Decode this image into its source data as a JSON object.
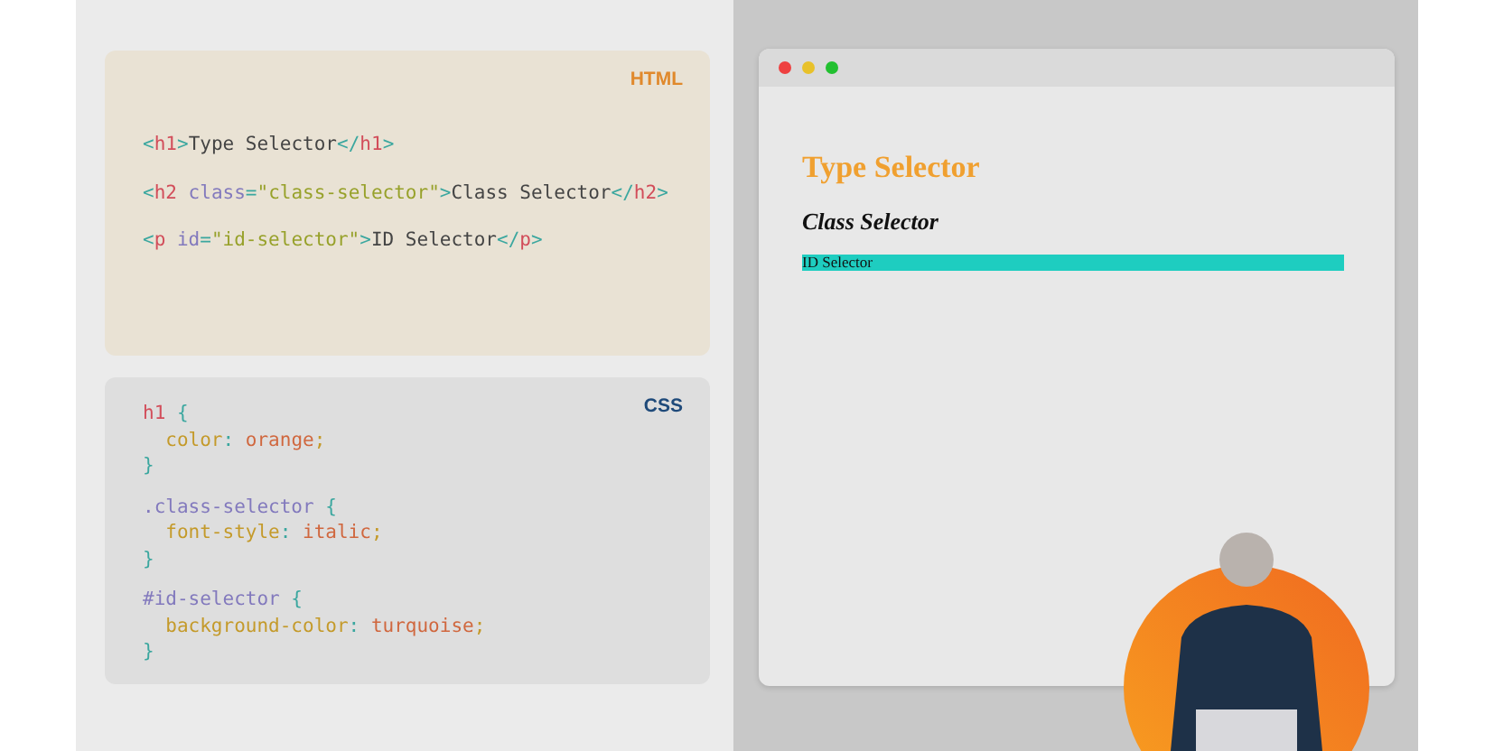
{
  "html_panel": {
    "label": "HTML",
    "lines": [
      {
        "tokens": [
          {
            "t": "<",
            "kind": "punct"
          },
          {
            "t": "h1",
            "kind": "tag"
          },
          {
            "t": ">",
            "kind": "punct"
          },
          {
            "t": "Type Selector",
            "kind": "text"
          },
          {
            "t": "</",
            "kind": "punct"
          },
          {
            "t": "h1",
            "kind": "tag"
          },
          {
            "t": ">",
            "kind": "punct"
          }
        ]
      },
      {
        "tokens": [
          {
            "t": "<",
            "kind": "punct"
          },
          {
            "t": "h2",
            "kind": "tag"
          },
          {
            "t": " class",
            "kind": "attr"
          },
          {
            "t": "=",
            "kind": "punct"
          },
          {
            "t": "\"class-selector\"",
            "kind": "string"
          },
          {
            "t": ">",
            "kind": "punct"
          },
          {
            "t": "Class Selector",
            "kind": "text"
          },
          {
            "t": "</",
            "kind": "punct"
          },
          {
            "t": "h2",
            "kind": "tag"
          },
          {
            "t": ">",
            "kind": "punct"
          }
        ]
      },
      {
        "tokens": [
          {
            "t": "<",
            "kind": "punct"
          },
          {
            "t": "p",
            "kind": "tag"
          },
          {
            "t": " id",
            "kind": "attr"
          },
          {
            "t": "=",
            "kind": "punct"
          },
          {
            "t": "\"id-selector\"",
            "kind": "string"
          },
          {
            "t": ">",
            "kind": "punct"
          },
          {
            "t": "ID Selector",
            "kind": "text"
          },
          {
            "t": "</",
            "kind": "punct"
          },
          {
            "t": "p",
            "kind": "tag"
          },
          {
            "t": ">",
            "kind": "punct"
          }
        ]
      }
    ]
  },
  "css_panel": {
    "label": "CSS",
    "blocks": [
      [
        {
          "indent": false,
          "tokens": [
            {
              "t": "h1",
              "kind": "tag"
            },
            {
              "t": " {",
              "kind": "punct"
            }
          ]
        },
        {
          "indent": true,
          "tokens": [
            {
              "t": "color",
              "kind": "prop"
            },
            {
              "t": ": ",
              "kind": "punct"
            },
            {
              "t": "orange",
              "kind": "value"
            },
            {
              "t": ";",
              "kind": "prop"
            }
          ]
        },
        {
          "indent": false,
          "tokens": [
            {
              "t": "}",
              "kind": "punct"
            }
          ]
        }
      ],
      [
        {
          "indent": false,
          "tokens": [
            {
              "t": ".class-selector",
              "kind": "attr"
            },
            {
              "t": " {",
              "kind": "punct"
            }
          ]
        },
        {
          "indent": true,
          "tokens": [
            {
              "t": "font-style",
              "kind": "prop"
            },
            {
              "t": ": ",
              "kind": "punct"
            },
            {
              "t": "italic",
              "kind": "value"
            },
            {
              "t": ";",
              "kind": "prop"
            }
          ]
        },
        {
          "indent": false,
          "tokens": [
            {
              "t": "}",
              "kind": "punct"
            }
          ]
        }
      ],
      [
        {
          "indent": false,
          "tokens": [
            {
              "t": "#id-selector",
              "kind": "attr"
            },
            {
              "t": " {",
              "kind": "punct"
            }
          ]
        },
        {
          "indent": true,
          "tokens": [
            {
              "t": "background-color",
              "kind": "prop"
            },
            {
              "t": ": ",
              "kind": "punct"
            },
            {
              "t": "turquoise",
              "kind": "value"
            },
            {
              "t": ";",
              "kind": "prop"
            }
          ]
        },
        {
          "indent": false,
          "tokens": [
            {
              "t": "}",
              "kind": "punct"
            }
          ]
        }
      ]
    ]
  },
  "browser": {
    "window_controls": [
      {
        "color": "#ee4040"
      },
      {
        "color": "#e8c12a"
      },
      {
        "color": "#22c030"
      }
    ],
    "heading_1": "Type Selector",
    "heading_2": "Class Selector",
    "paragraph": "ID Selector"
  }
}
